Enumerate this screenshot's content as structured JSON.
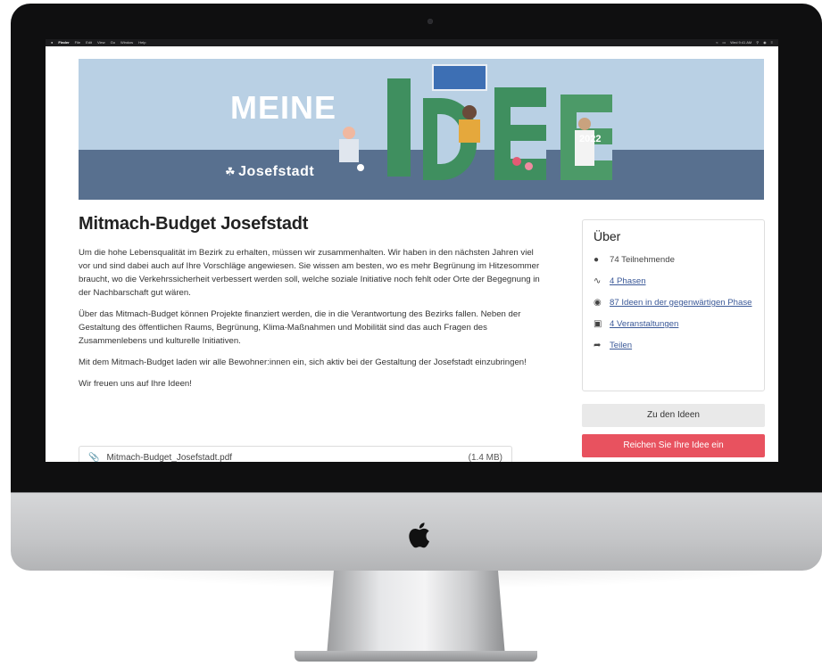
{
  "menubar": {
    "app": "Finder",
    "items": [
      "File",
      "Edit",
      "View",
      "Go",
      "Window",
      "Help"
    ],
    "clock": "Wed 9:41 AM"
  },
  "banner": {
    "title": "MEINE",
    "idea_word": "IDEE",
    "district": "Josefstadt",
    "year": "2022",
    "colors": {
      "sky": "#b9d0e4",
      "ground": "#58708f",
      "letters": "#3f8f5f"
    }
  },
  "main": {
    "title": "Mitmach-Budget Josefstadt",
    "paragraphs": [
      "Um die hohe Lebensqualität im Bezirk zu erhalten, müssen wir zusammenhalten. Wir haben in den nächsten Jahren viel vor und sind dabei auch auf Ihre Vorschläge angewiesen. Sie wissen am besten, wo es mehr Begrünung im Hitzesommer braucht, wo die Verkehrssicherheit verbessert werden soll, welche soziale Initiative noch fehlt oder Orte der Begegnung in der Nachbarschaft gut wären.",
      "Über das Mitmach-Budget können Projekte finanziert werden, die in die Verantwortung des Bezirks fallen. Neben der Gestaltung des öffentlichen Raums, Begrünung, Klima-Maßnahmen und Mobilität sind das auch Fragen des Zusammenlebens und kulturelle Initiativen.",
      "Mit dem Mitmach-Budget laden wir alle Bewohner:innen ein, sich aktiv bei der Gestaltung der Josefstadt einzubringen!",
      "Wir freuen uns auf Ihre Ideen!"
    ],
    "attachment": {
      "name": "Mitmach-Budget_Josefstadt.pdf",
      "size": "(1.4 MB)"
    }
  },
  "sidebar": {
    "title": "Über",
    "participants": "74 Teilnehmende",
    "phases": "4 Phasen",
    "ideas": "87 Ideen in der gegenwärtigen Phase",
    "events": "4 Veranstaltungen",
    "share": "Teilen",
    "btn_ideas": "Zu den Ideen",
    "btn_submit": "Reichen Sie Ihre Idee ein",
    "colors": {
      "submit": "#e8525f",
      "link": "#3b5998"
    }
  }
}
